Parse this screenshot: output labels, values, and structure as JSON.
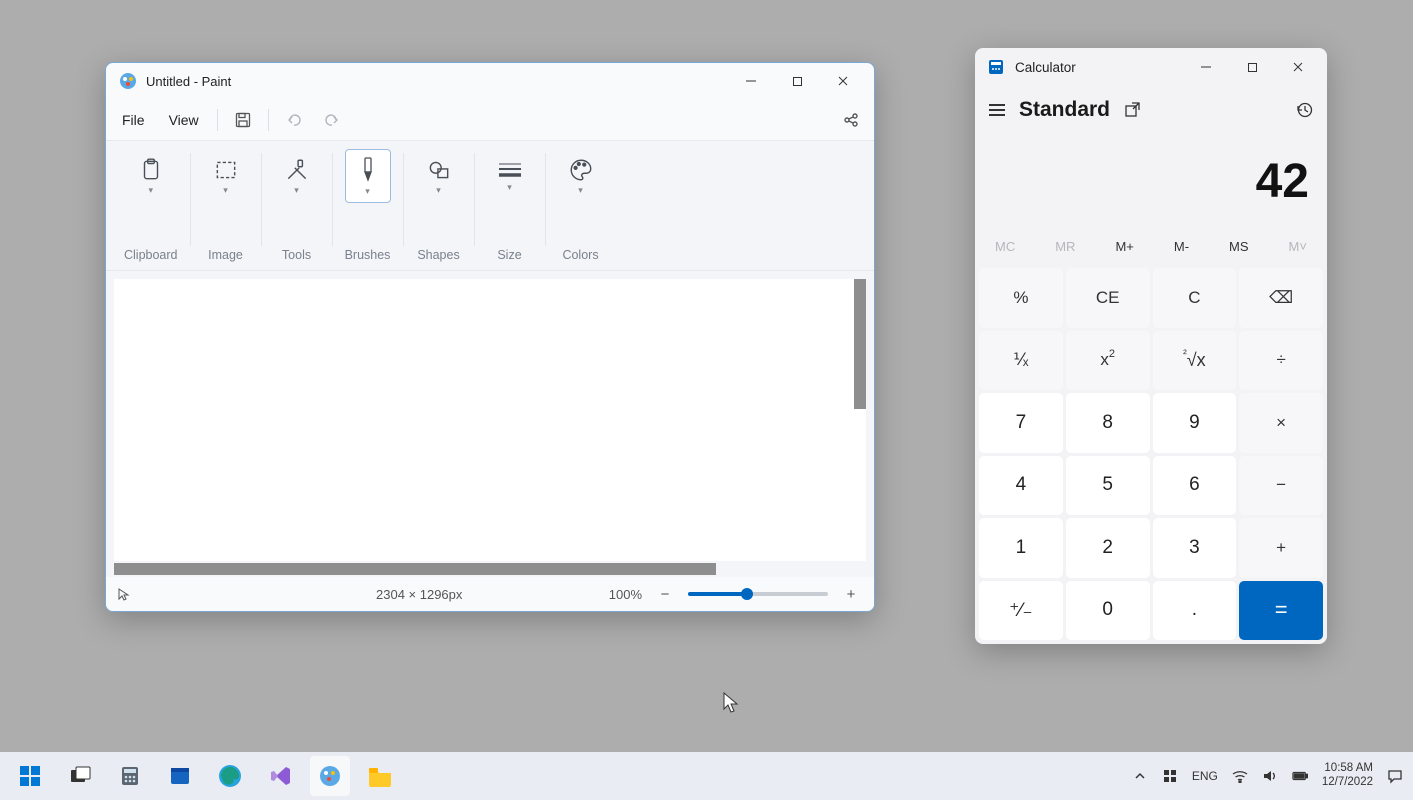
{
  "paint": {
    "title": "Untitled - Paint",
    "menu": {
      "file": "File",
      "view": "View"
    },
    "ribbon": {
      "clipboard": "Clipboard",
      "image": "Image",
      "tools": "Tools",
      "brushes": "Brushes",
      "shapes": "Shapes",
      "size": "Size",
      "colors": "Colors"
    },
    "status": {
      "dimensions": "2304 × 1296px",
      "zoom": "100%"
    }
  },
  "calculator": {
    "title": "Calculator",
    "mode": "Standard",
    "display": "42",
    "memory": {
      "mc": "MC",
      "mr": "MR",
      "mplus": "M+",
      "mminus": "M-",
      "ms": "MS",
      "mlist": "M˅"
    },
    "keys": {
      "percent": "%",
      "ce": "CE",
      "c": "C",
      "back": "⌫",
      "inv": "⅟ₓ",
      "sq_base": "x",
      "sq_sup": "2",
      "sqrt_pre": "²",
      "sqrt": "√x",
      "div": "÷",
      "7": "7",
      "8": "8",
      "9": "9",
      "mul": "×",
      "4": "4",
      "5": "5",
      "6": "6",
      "sub": "−",
      "1": "1",
      "2": "2",
      "3": "3",
      "add": "+",
      "neg": "⁺⁄₋",
      "0": "0",
      "dot": ".",
      "eq": "="
    }
  },
  "taskbar": {
    "lang": "ENG",
    "time": "10:58 AM",
    "date": "12/7/2022"
  }
}
